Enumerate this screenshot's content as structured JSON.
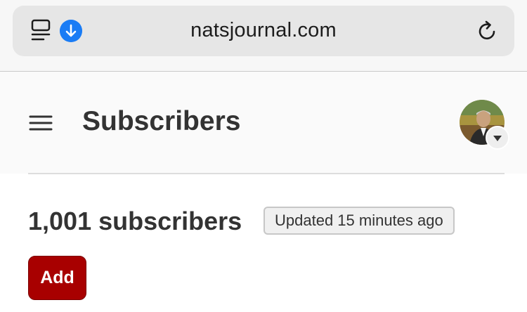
{
  "browser": {
    "url": "natsjournal.com",
    "icons": {
      "reader": "reader-mode-icon",
      "download": "download-arrow-icon",
      "reload": "reload-icon"
    },
    "accent_color": "#1a7cf5"
  },
  "header": {
    "menu_icon": "hamburger-menu-icon",
    "title": "Subscribers",
    "avatar_caret_icon": "caret-down-icon"
  },
  "main": {
    "subscriber_count_text": "1,001 subscribers",
    "updated_badge": "Updated 15 minutes ago",
    "add_label": "Add",
    "add_color": "#a80000"
  }
}
